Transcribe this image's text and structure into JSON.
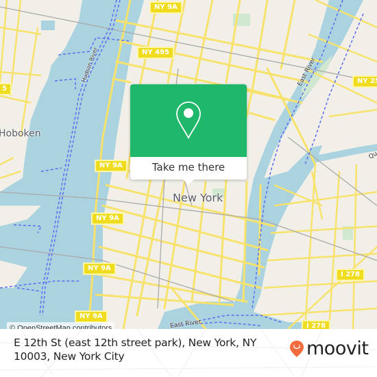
{
  "map": {
    "place_labels": {
      "city": "New York",
      "hoboken": "Hoboken"
    },
    "water_labels": {
      "east_river_north": "East River",
      "east_river_south": "East River",
      "hudson": "Hudson River",
      "queens": "Qu"
    },
    "shields": [
      {
        "id": "ny9a-1",
        "label": "NY 9A"
      },
      {
        "id": "ny495",
        "label": "NY 495"
      },
      {
        "id": "ny25",
        "label": "NY 25"
      },
      {
        "id": "i495-left",
        "label": "5"
      },
      {
        "id": "ny9a-2",
        "label": "NY 9A"
      },
      {
        "id": "ny9a-3",
        "label": "NY 9A"
      },
      {
        "id": "ny9a-4",
        "label": "NY 9A"
      },
      {
        "id": "ny9a-5",
        "label": "NY 9A"
      },
      {
        "id": "i278-1",
        "label": "I 278"
      },
      {
        "id": "i278-2",
        "label": "I 278"
      }
    ],
    "attribution": "© OpenStreetMap contributors",
    "colors": {
      "land": "#f2efe9",
      "water": "#aad3df",
      "road": "#f7e26b",
      "ferry": "#5b6cf0",
      "rail": "#999999"
    }
  },
  "popup": {
    "icon": "map-pin-icon",
    "button_label": "Take me there",
    "color": "#1fb86a"
  },
  "footer": {
    "address": "E 12th St (east 12th street park), New York, NY 10003, New York City",
    "brand": "moovit",
    "brand_icon": "moovit-pin-icon",
    "brand_color": "#f26a3d"
  }
}
